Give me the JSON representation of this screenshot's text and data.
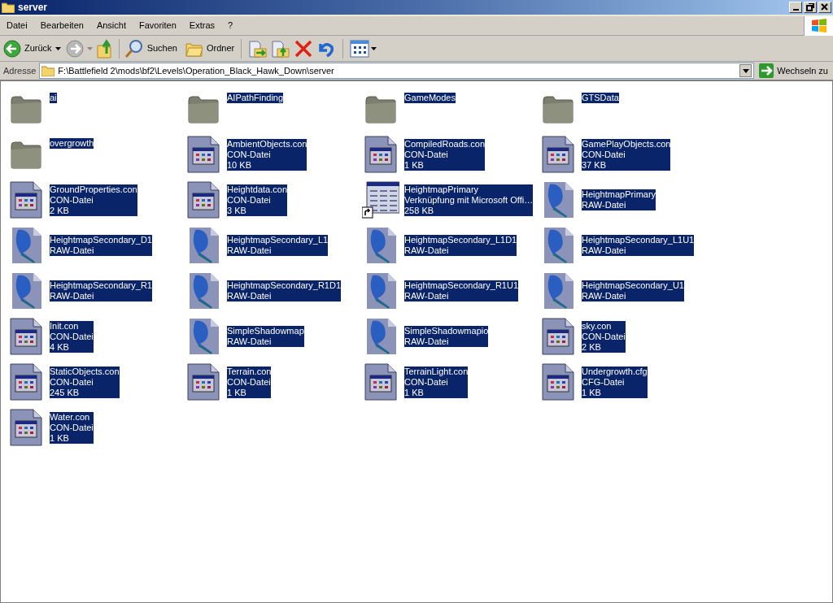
{
  "window": {
    "title": "server"
  },
  "menu": [
    "Datei",
    "Bearbeiten",
    "Ansicht",
    "Favoriten",
    "Extras",
    "?"
  ],
  "toolbar": {
    "back": "Zurück",
    "search": "Suchen",
    "folders": "Ordner"
  },
  "address": {
    "label": "Adresse",
    "value": "F:\\Battlefield 2\\mods\\bf2\\Levels\\Operation_Black_Hawk_Down\\server",
    "go": "Wechseln zu"
  },
  "files": [
    {
      "kind": "folder",
      "name": "ai",
      "selected": true
    },
    {
      "kind": "folder",
      "name": "AIPathFinding",
      "selected": true
    },
    {
      "kind": "folder",
      "name": "GameModes",
      "selected": true
    },
    {
      "kind": "folder",
      "name": "GTSData",
      "selected": true
    },
    {
      "kind": "folder",
      "name": "overgrowth",
      "selected": true
    },
    {
      "kind": "con",
      "name": "AmbientObjects.con",
      "type": "CON-Datei",
      "size": "10 KB",
      "selected": true
    },
    {
      "kind": "con",
      "name": "CompiledRoads.con",
      "type": "CON-Datei",
      "size": "1 KB",
      "selected": true
    },
    {
      "kind": "con",
      "name": "GamePlayObjects.con",
      "type": "CON-Datei",
      "size": "37 KB",
      "selected": true
    },
    {
      "kind": "con",
      "name": "GroundProperties.con",
      "type": "CON-Datei",
      "size": "2 KB",
      "selected": true
    },
    {
      "kind": "con",
      "name": "Heightdata.con",
      "type": "CON-Datei",
      "size": "3 KB",
      "selected": true
    },
    {
      "kind": "shortcut",
      "name": "HeightmapPrimary",
      "type": "Verknüpfung mit Microsoft Offi…",
      "size": "258 KB",
      "selected": true
    },
    {
      "kind": "raw",
      "name": "HeightmapPrimary",
      "type": "RAW-Datei",
      "selected": true
    },
    {
      "kind": "raw",
      "name": "HeightmapSecondary_D1",
      "type": "RAW-Datei",
      "selected": true
    },
    {
      "kind": "raw",
      "name": "HeightmapSecondary_L1",
      "type": "RAW-Datei",
      "selected": true
    },
    {
      "kind": "raw",
      "name": "HeightmapSecondary_L1D1",
      "type": "RAW-Datei",
      "selected": true
    },
    {
      "kind": "raw",
      "name": "HeightmapSecondary_L1U1",
      "type": "RAW-Datei",
      "selected": true
    },
    {
      "kind": "raw",
      "name": "HeightmapSecondary_R1",
      "type": "RAW-Datei",
      "selected": true
    },
    {
      "kind": "raw",
      "name": "HeightmapSecondary_R1D1",
      "type": "RAW-Datei",
      "selected": true
    },
    {
      "kind": "raw",
      "name": "HeightmapSecondary_R1U1",
      "type": "RAW-Datei",
      "selected": true
    },
    {
      "kind": "raw",
      "name": "HeightmapSecondary_U1",
      "type": "RAW-Datei",
      "selected": true
    },
    {
      "kind": "con",
      "name": "Init.con",
      "type": "CON-Datei",
      "size": "4 KB",
      "selected": true
    },
    {
      "kind": "raw",
      "name": "SimpleShadowmap",
      "type": "RAW-Datei",
      "selected": true
    },
    {
      "kind": "raw",
      "name": "SimpleShadowmapio",
      "type": "RAW-Datei",
      "selected": true
    },
    {
      "kind": "con",
      "name": "sky.con",
      "type": "CON-Datei",
      "size": "2 KB",
      "selected": true
    },
    {
      "kind": "con",
      "name": "StaticObjects.con",
      "type": "CON-Datei",
      "size": "245 KB",
      "selected": true
    },
    {
      "kind": "con",
      "name": "Terrain.con",
      "type": "CON-Datei",
      "size": "1 KB",
      "selected": true
    },
    {
      "kind": "con",
      "name": "TerrainLight.con",
      "type": "CON-Datei",
      "size": "1 KB",
      "selected": true
    },
    {
      "kind": "con",
      "name": "Undergrowth.cfg",
      "type": "CFG-Datei",
      "size": "1 KB",
      "selected": true
    },
    {
      "kind": "con",
      "name": "Water.con",
      "type": "CON-Datei",
      "size": "1 KB",
      "selected": true
    }
  ]
}
